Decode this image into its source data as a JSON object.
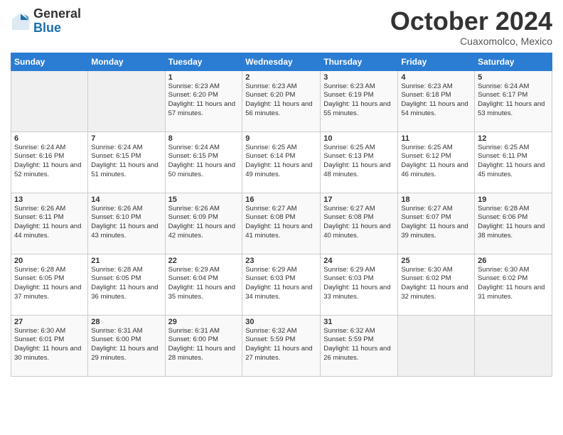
{
  "header": {
    "logo_general": "General",
    "logo_blue": "Blue",
    "month_title": "October 2024",
    "location": "Cuaxomolco, Mexico"
  },
  "days_of_week": [
    "Sunday",
    "Monday",
    "Tuesday",
    "Wednesday",
    "Thursday",
    "Friday",
    "Saturday"
  ],
  "weeks": [
    [
      {
        "day": "",
        "info": ""
      },
      {
        "day": "",
        "info": ""
      },
      {
        "day": "1",
        "info": "Sunrise: 6:23 AM\nSunset: 6:20 PM\nDaylight: 11 hours and 57 minutes."
      },
      {
        "day": "2",
        "info": "Sunrise: 6:23 AM\nSunset: 6:20 PM\nDaylight: 11 hours and 56 minutes."
      },
      {
        "day": "3",
        "info": "Sunrise: 6:23 AM\nSunset: 6:19 PM\nDaylight: 11 hours and 55 minutes."
      },
      {
        "day": "4",
        "info": "Sunrise: 6:23 AM\nSunset: 6:18 PM\nDaylight: 11 hours and 54 minutes."
      },
      {
        "day": "5",
        "info": "Sunrise: 6:24 AM\nSunset: 6:17 PM\nDaylight: 11 hours and 53 minutes."
      }
    ],
    [
      {
        "day": "6",
        "info": "Sunrise: 6:24 AM\nSunset: 6:16 PM\nDaylight: 11 hours and 52 minutes."
      },
      {
        "day": "7",
        "info": "Sunrise: 6:24 AM\nSunset: 6:15 PM\nDaylight: 11 hours and 51 minutes."
      },
      {
        "day": "8",
        "info": "Sunrise: 6:24 AM\nSunset: 6:15 PM\nDaylight: 11 hours and 50 minutes."
      },
      {
        "day": "9",
        "info": "Sunrise: 6:25 AM\nSunset: 6:14 PM\nDaylight: 11 hours and 49 minutes."
      },
      {
        "day": "10",
        "info": "Sunrise: 6:25 AM\nSunset: 6:13 PM\nDaylight: 11 hours and 48 minutes."
      },
      {
        "day": "11",
        "info": "Sunrise: 6:25 AM\nSunset: 6:12 PM\nDaylight: 11 hours and 46 minutes."
      },
      {
        "day": "12",
        "info": "Sunrise: 6:25 AM\nSunset: 6:11 PM\nDaylight: 11 hours and 45 minutes."
      }
    ],
    [
      {
        "day": "13",
        "info": "Sunrise: 6:26 AM\nSunset: 6:11 PM\nDaylight: 11 hours and 44 minutes."
      },
      {
        "day": "14",
        "info": "Sunrise: 6:26 AM\nSunset: 6:10 PM\nDaylight: 11 hours and 43 minutes."
      },
      {
        "day": "15",
        "info": "Sunrise: 6:26 AM\nSunset: 6:09 PM\nDaylight: 11 hours and 42 minutes."
      },
      {
        "day": "16",
        "info": "Sunrise: 6:27 AM\nSunset: 6:08 PM\nDaylight: 11 hours and 41 minutes."
      },
      {
        "day": "17",
        "info": "Sunrise: 6:27 AM\nSunset: 6:08 PM\nDaylight: 11 hours and 40 minutes."
      },
      {
        "day": "18",
        "info": "Sunrise: 6:27 AM\nSunset: 6:07 PM\nDaylight: 11 hours and 39 minutes."
      },
      {
        "day": "19",
        "info": "Sunrise: 6:28 AM\nSunset: 6:06 PM\nDaylight: 11 hours and 38 minutes."
      }
    ],
    [
      {
        "day": "20",
        "info": "Sunrise: 6:28 AM\nSunset: 6:05 PM\nDaylight: 11 hours and 37 minutes."
      },
      {
        "day": "21",
        "info": "Sunrise: 6:28 AM\nSunset: 6:05 PM\nDaylight: 11 hours and 36 minutes."
      },
      {
        "day": "22",
        "info": "Sunrise: 6:29 AM\nSunset: 6:04 PM\nDaylight: 11 hours and 35 minutes."
      },
      {
        "day": "23",
        "info": "Sunrise: 6:29 AM\nSunset: 6:03 PM\nDaylight: 11 hours and 34 minutes."
      },
      {
        "day": "24",
        "info": "Sunrise: 6:29 AM\nSunset: 6:03 PM\nDaylight: 11 hours and 33 minutes."
      },
      {
        "day": "25",
        "info": "Sunrise: 6:30 AM\nSunset: 6:02 PM\nDaylight: 11 hours and 32 minutes."
      },
      {
        "day": "26",
        "info": "Sunrise: 6:30 AM\nSunset: 6:02 PM\nDaylight: 11 hours and 31 minutes."
      }
    ],
    [
      {
        "day": "27",
        "info": "Sunrise: 6:30 AM\nSunset: 6:01 PM\nDaylight: 11 hours and 30 minutes."
      },
      {
        "day": "28",
        "info": "Sunrise: 6:31 AM\nSunset: 6:00 PM\nDaylight: 11 hours and 29 minutes."
      },
      {
        "day": "29",
        "info": "Sunrise: 6:31 AM\nSunset: 6:00 PM\nDaylight: 11 hours and 28 minutes."
      },
      {
        "day": "30",
        "info": "Sunrise: 6:32 AM\nSunset: 5:59 PM\nDaylight: 11 hours and 27 minutes."
      },
      {
        "day": "31",
        "info": "Sunrise: 6:32 AM\nSunset: 5:59 PM\nDaylight: 11 hours and 26 minutes."
      },
      {
        "day": "",
        "info": ""
      },
      {
        "day": "",
        "info": ""
      }
    ]
  ]
}
